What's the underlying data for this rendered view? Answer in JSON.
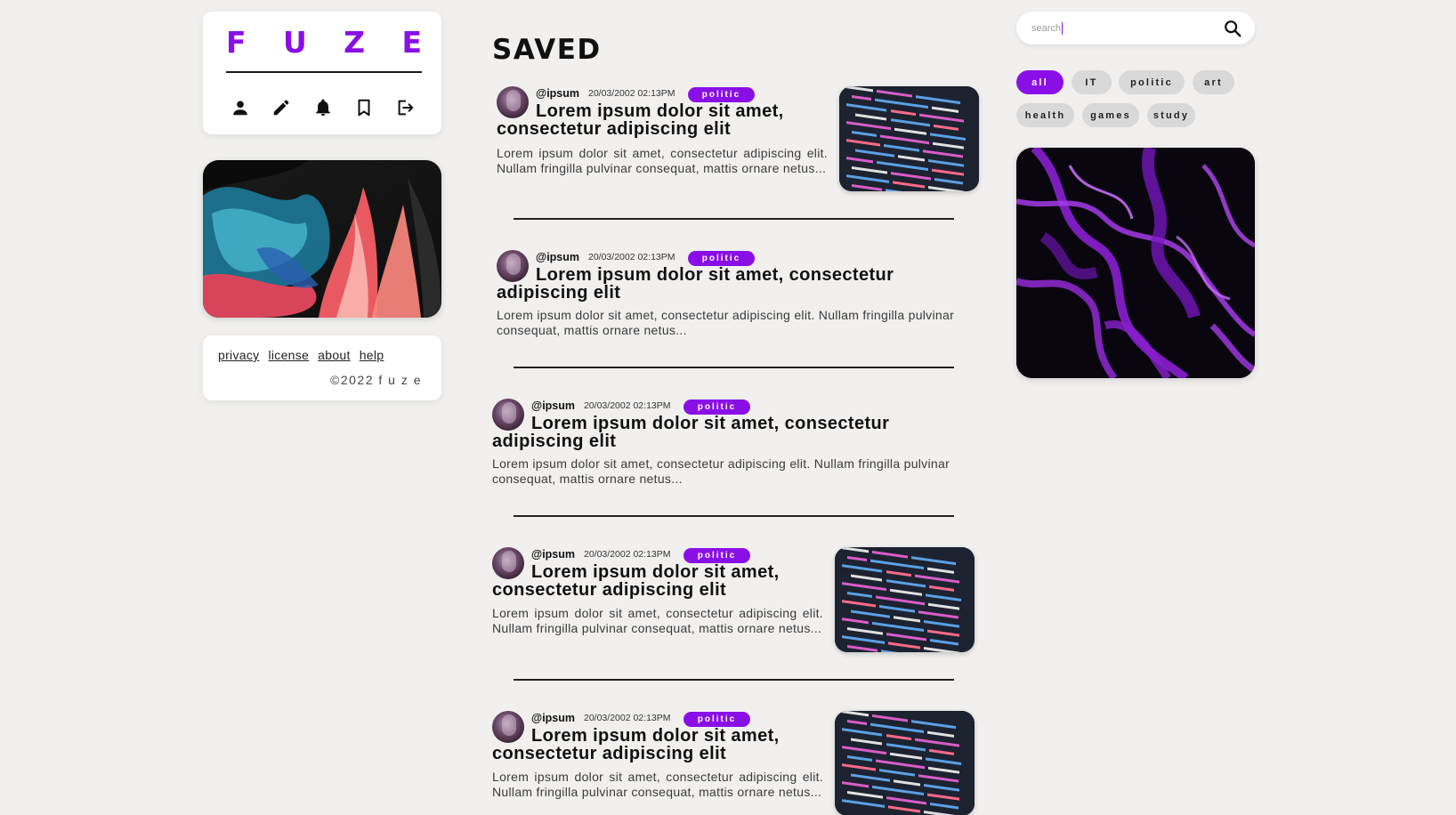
{
  "brand": {
    "letters": [
      "F",
      "U",
      "Z",
      "E"
    ],
    "accent": "#8a0fe6"
  },
  "nav": {
    "items": [
      {
        "icon": "user-icon"
      },
      {
        "icon": "pencil-icon"
      },
      {
        "icon": "bell-icon"
      },
      {
        "icon": "bookmark-icon"
      },
      {
        "icon": "logout-icon"
      }
    ]
  },
  "footer": {
    "links": [
      "privacy",
      "license",
      "about",
      "help"
    ],
    "copyright": "©2022 f u z e"
  },
  "main": {
    "title": "SAVED",
    "posts": [
      {
        "user": "@ipsum",
        "date": "20/03/2002 02:13PM",
        "tag": "politic",
        "title": "Lorem ipsum dolor sit amet, consectetur adipiscing elit",
        "excerpt": "Lorem ipsum dolor sit amet, consectetur adipiscing elit. Nullam fringilla pulvinar consequat, mattis ornare netus...",
        "has_image": true
      },
      {
        "user": "@ipsum",
        "date": "20/03/2002 02:13PM",
        "tag": "politic",
        "title": "Lorem ipsum dolor sit amet, consectetur adipiscing elit",
        "excerpt": "Lorem ipsum dolor sit amet, consectetur adipiscing elit. Nullam fringilla pulvinar consequat, mattis ornare netus...",
        "has_image": false
      },
      {
        "user": "@ipsum",
        "date": "20/03/2002 02:13PM",
        "tag": "politic",
        "title": "Lorem ipsum dolor sit amet, consectetur adipiscing elit",
        "excerpt": "Lorem ipsum dolor sit amet, consectetur adipiscing elit. Nullam fringilla pulvinar consequat, mattis ornare netus...",
        "has_image": false
      },
      {
        "user": "@ipsum",
        "date": "20/03/2002 02:13PM",
        "tag": "politic",
        "title": "Lorem ipsum dolor sit amet, consectetur adipiscing elit",
        "excerpt": "Lorem ipsum dolor sit amet, consectetur adipiscing elit. Nullam fringilla pulvinar consequat, mattis ornare netus...",
        "has_image": true
      },
      {
        "user": "@ipsum",
        "date": "20/03/2002 02:13PM",
        "tag": "politic",
        "title": "Lorem ipsum dolor sit amet, consectetur adipiscing elit",
        "excerpt": "Lorem ipsum dolor sit amet, consectetur adipiscing elit. Nullam fringilla pulvinar consequat, mattis ornare netus...",
        "has_image": true
      }
    ]
  },
  "search": {
    "placeholder": "search",
    "icon": "search-icon"
  },
  "tags": [
    {
      "label": "all",
      "active": true
    },
    {
      "label": "IT",
      "active": false
    },
    {
      "label": "politic",
      "active": false
    },
    {
      "label": "art",
      "active": false
    },
    {
      "label": "health",
      "active": false
    },
    {
      "label": "games",
      "active": false
    },
    {
      "label": "study",
      "active": false
    }
  ]
}
